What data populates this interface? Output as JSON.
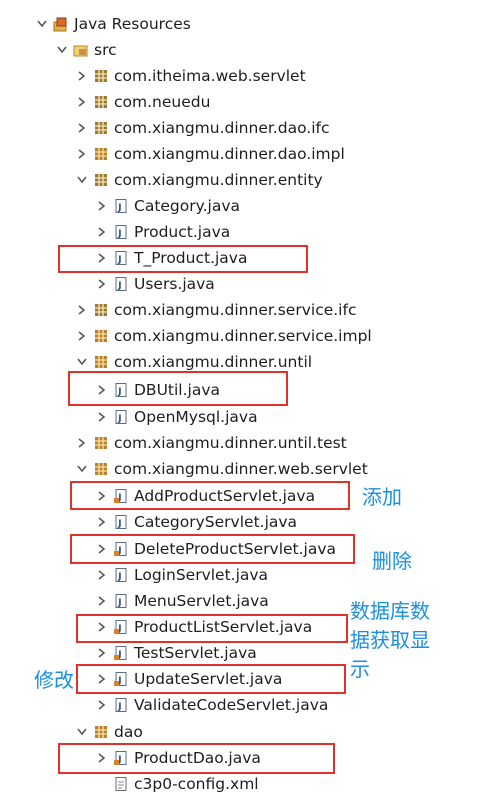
{
  "tree": {
    "root": {
      "label": "Java Resources"
    },
    "src": {
      "label": "src"
    },
    "packages": {
      "servlet": "com.itheima.web.servlet",
      "neuedu": "com.neuedu",
      "dao_ifc": "com.xiangmu.dinner.dao.ifc",
      "dao_impl": "com.xiangmu.dinner.dao.impl",
      "entity": "com.xiangmu.dinner.entity",
      "service_ifc": "com.xiangmu.dinner.service.ifc",
      "service_impl": "com.xiangmu.dinner.service.impl",
      "until": "com.xiangmu.dinner.until",
      "until_test": "com.xiangmu.dinner.until.test",
      "web_servlet": "com.xiangmu.dinner.web.servlet"
    },
    "entity_files": [
      "Category.java",
      "Product.java",
      "T_Product.java",
      "Users.java"
    ],
    "until_files": [
      "DBUtil.java",
      "OpenMysql.java"
    ],
    "servlet_files": [
      "AddProductServlet.java",
      "CategoryServlet.java",
      "DeleteProductServlet.java",
      "LoginServlet.java",
      "MenuServlet.java",
      "ProductListServlet.java",
      "TestServlet.java",
      "UpdateServlet.java",
      "ValidateCodeServlet.java"
    ],
    "dao": {
      "label": "dao",
      "files": [
        "ProductDao.java"
      ]
    },
    "config_file": "c3p0-config.xml"
  },
  "annotations": {
    "add": "添加",
    "delete": "删除",
    "list_line1": "数据库数",
    "list_line2": "据获取显",
    "list_line3": "示",
    "update": "修改"
  },
  "colors": {
    "highlight_border": "#e0312b",
    "annotation_text": "#1b8fe3",
    "package_icon": "#8a6a2a",
    "file_icon": "#5a6c86"
  }
}
